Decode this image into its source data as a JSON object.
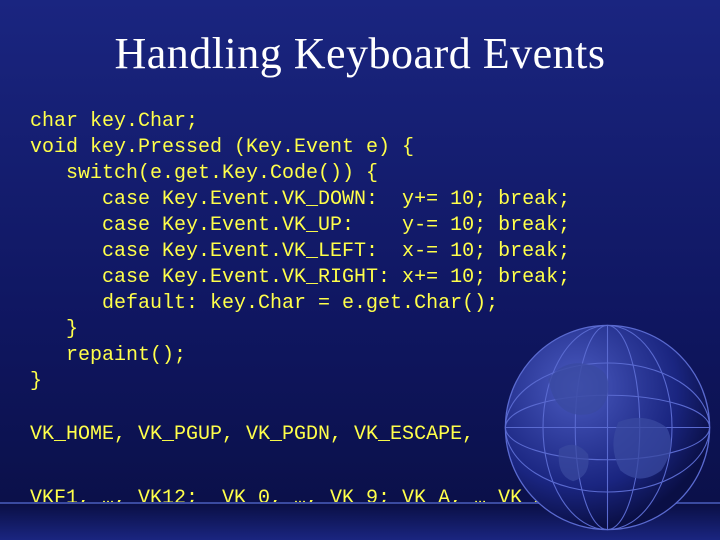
{
  "title": "Handling Keyboard Events",
  "code_lines": [
    "char key.Char;",
    "void key.Pressed (Key.Event e) {",
    "   switch(e.get.Key.Code()) {",
    "      case Key.Event.VK_DOWN:  y+= 10; break;",
    "      case Key.Event.VK_UP:    y-= 10; break;",
    "      case Key.Event.VK_LEFT:  x-= 10; break;",
    "      case Key.Event.VK_RIGHT: x+= 10; break;",
    "      default: key.Char = e.get.Char();",
    "   }",
    "   repaint();",
    "}"
  ],
  "constants_lines": [
    "VK_HOME, VK_PGUP, VK_PGDN, VK_ESCAPE,",
    "",
    "VKF1, …, VK12;  VK_0, …, VK_9; VK_A, … VK_Z; ..."
  ]
}
